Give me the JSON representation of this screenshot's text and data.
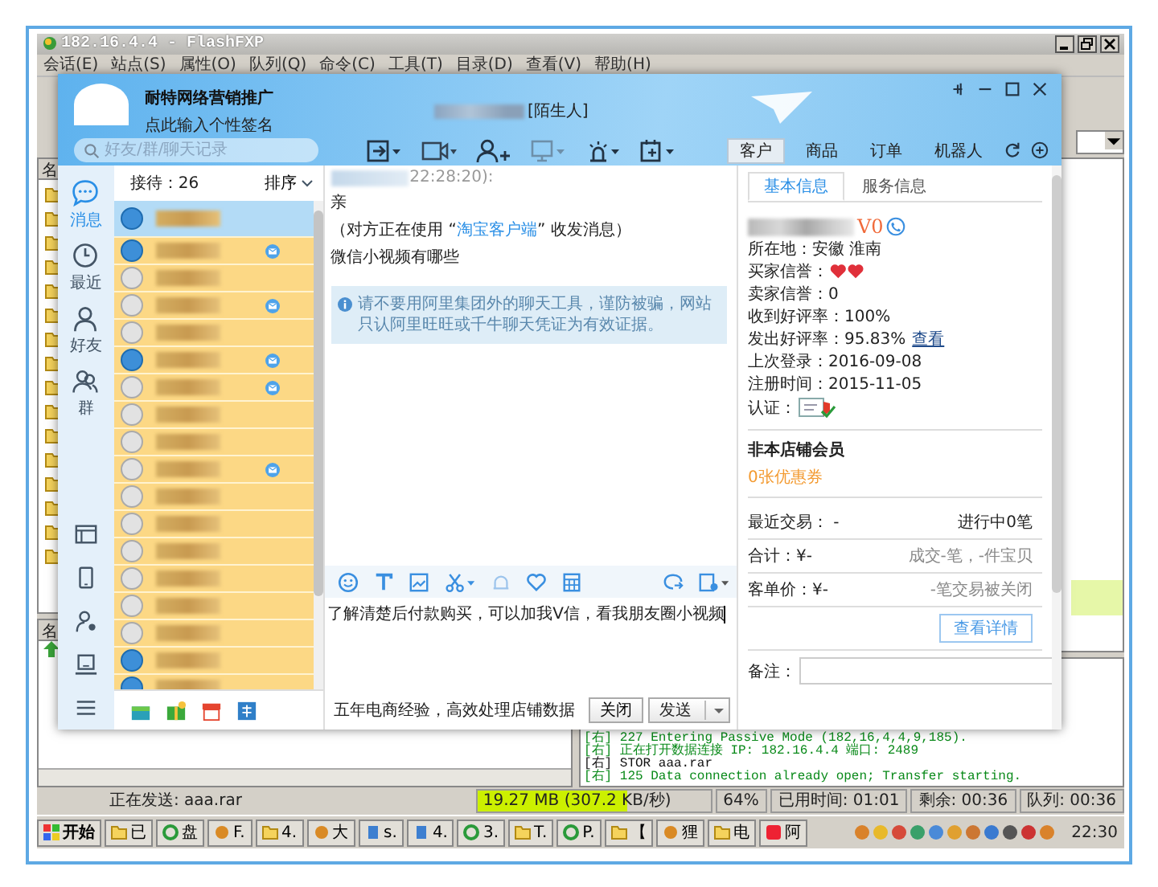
{
  "ftp": {
    "title": "182.16.4.4 - FlashFXP",
    "menu": [
      "会话(E)",
      "站点(S)",
      "属性(O)",
      "队列(Q)",
      "命令(C)",
      "工具(T)",
      "目录(D)",
      "查看(V)",
      "帮助(H)"
    ],
    "local_header": "名",
    "queue_header": "名",
    "log": [
      {
        "kind": "reply",
        "text": "[右] 227 Entering Passive Mode (182,16,4,4,9,185)."
      },
      {
        "kind": "reply",
        "text": "[右] 正在打开数据连接 IP: 182.16.4.4 端口: 2489"
      },
      {
        "kind": "command",
        "text": "[右] STOR aaa.rar"
      },
      {
        "kind": "reply",
        "text": "[右] 125 Data connection already open; Transfer starting."
      }
    ],
    "status": {
      "message": "正在发送: aaa.rar",
      "transfer": "19.27 MB (307.2 KB/秒)",
      "level": 0.64,
      "percent": "64%",
      "elapsed": "已用时间: 01:01",
      "remaining": "剩余: 00:36",
      "queue": "队列: 00:36"
    }
  },
  "taskbar": {
    "start": "开始",
    "items": [
      {
        "kind": "folder",
        "label": "已"
      },
      {
        "kind": "browser",
        "label": "盘"
      },
      {
        "kind": "app",
        "label": "F."
      },
      {
        "kind": "folder",
        "label": "4."
      },
      {
        "kind": "app",
        "label": "大"
      },
      {
        "kind": "doc",
        "label": "s."
      },
      {
        "kind": "doc",
        "label": "4."
      },
      {
        "kind": "browser",
        "label": "3."
      },
      {
        "kind": "folder",
        "label": "T."
      },
      {
        "kind": "browser",
        "label": "P."
      },
      {
        "kind": "folder",
        "label": "【"
      },
      {
        "kind": "app",
        "label": "狸"
      },
      {
        "kind": "folder",
        "label": "电"
      },
      {
        "kind": "chat",
        "label": "阿"
      }
    ],
    "clock": "22:30"
  },
  "chat": {
    "account": {
      "name": "耐特网络营销推广",
      "signature": "点此输入个性签名"
    },
    "peer_tag": "[陌生人]",
    "search": {
      "placeholder": "好友/群/聊天记录"
    },
    "side_tabs": [
      {
        "label": "客户",
        "selected": true
      },
      {
        "label": "商品",
        "selected": false
      },
      {
        "label": "订单",
        "selected": false
      },
      {
        "label": "机器人",
        "selected": false
      }
    ],
    "nav": [
      {
        "kind": "message",
        "label": "消息",
        "selected": true
      },
      {
        "kind": "recent",
        "label": "最近",
        "selected": false
      },
      {
        "kind": "friend",
        "label": "好友",
        "selected": false
      },
      {
        "kind": "group",
        "label": "群",
        "selected": false
      }
    ],
    "contacts": {
      "count_label": "接待：26",
      "sort_label": "排序",
      "items": [
        {
          "selected": true,
          "online": true,
          "unread": false
        },
        {
          "selected": false,
          "online": true,
          "unread": true
        },
        {
          "selected": false,
          "online": false,
          "unread": false
        },
        {
          "selected": false,
          "online": false,
          "unread": true
        },
        {
          "selected": false,
          "online": false,
          "unread": false
        },
        {
          "selected": false,
          "online": true,
          "unread": true
        },
        {
          "selected": false,
          "online": false,
          "unread": true
        },
        {
          "selected": false,
          "online": false,
          "unread": false
        },
        {
          "selected": false,
          "online": false,
          "unread": false
        },
        {
          "selected": false,
          "online": false,
          "unread": true
        },
        {
          "selected": false,
          "online": false,
          "unread": false
        },
        {
          "selected": false,
          "online": false,
          "unread": false
        },
        {
          "selected": false,
          "online": false,
          "unread": false
        },
        {
          "selected": false,
          "online": false,
          "unread": false
        },
        {
          "selected": false,
          "online": false,
          "unread": false
        },
        {
          "selected": false,
          "online": false,
          "unread": false
        },
        {
          "selected": false,
          "online": true,
          "unread": false
        },
        {
          "selected": false,
          "online": true,
          "unread": false
        }
      ]
    },
    "conversation": {
      "time": "22:28:20):",
      "messages": [
        {
          "kind": "plain",
          "text": "亲"
        },
        {
          "kind": "status",
          "before": "（对方正在使用 “",
          "link": "淘宝客户端",
          "after": "” 收发消息）"
        },
        {
          "kind": "plain",
          "text": "微信小视频有哪些"
        }
      ],
      "notice": "请不要用阿里集团外的聊天工具，谨防被骗，网站只认阿里旺旺或千牛聊天凭证为有效证据。",
      "input": "了解清楚后付款购买，可以加我V信，看我朋友圈小视频",
      "ad": "五年电商经验，高效处理店铺数据",
      "close_button": "关闭",
      "send_button": "发送"
    },
    "profile": {
      "tabs": [
        {
          "label": "基本信息",
          "selected": true
        },
        {
          "label": "服务信息",
          "selected": false
        }
      ],
      "level_badge": "V0",
      "fields": [
        {
          "kind": "text",
          "text": "所在地：安徽 淮南"
        },
        {
          "kind": "hearts",
          "text": "买家信誉："
        },
        {
          "kind": "text",
          "text": "卖家信誉：0"
        },
        {
          "kind": "text",
          "text": "收到好评率：100%"
        },
        {
          "kind": "text",
          "text": "发出好评率：95.83%",
          "link": "查看"
        },
        {
          "kind": "text",
          "text": "上次登录：2016-09-08"
        },
        {
          "kind": "text",
          "text": "注册时间：2015-11-05"
        },
        {
          "kind": "badge",
          "text": "认证："
        }
      ],
      "membership": "非本店铺会员",
      "coupons": "0张优惠券",
      "stats": [
        {
          "left": "最近交易： -",
          "right": "进行中0笔"
        },
        {
          "left": "合计：¥-",
          "right": "成交-笔，-件宝贝"
        },
        {
          "left": "客单价：¥-",
          "right": "-笔交易被关闭"
        }
      ],
      "details_button": "查看详情",
      "note_label": "备注："
    }
  }
}
